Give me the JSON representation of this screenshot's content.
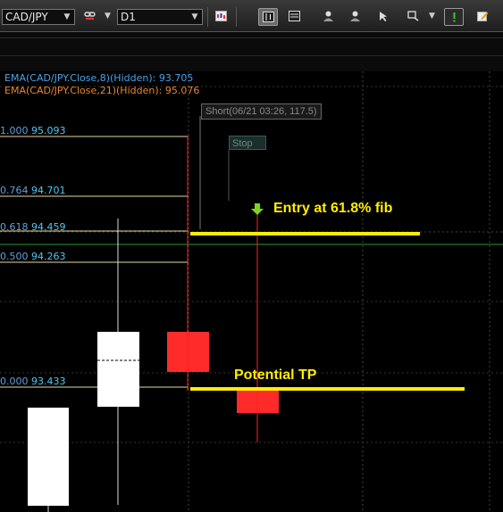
{
  "toolbar": {
    "symbol": "CAD/JPY",
    "timeframe": "D1"
  },
  "indicators": [
    {
      "text": "EMA(CAD/JPY.Close,8)(Hidden): 93.705",
      "color": "#4aa3e8"
    },
    {
      "text": "EMA(CAD/JPY.Close,21)(Hidden): 95.076",
      "color": "#e8862a"
    }
  ],
  "fib_levels": [
    {
      "ratio": "1.000",
      "price": "95.093"
    },
    {
      "ratio": "0.764",
      "price": "94.701"
    },
    {
      "ratio": "0.618",
      "price": "94.459"
    },
    {
      "ratio": "0.500",
      "price": "94.263"
    },
    {
      "ratio": "0.000",
      "price": "93.433"
    }
  ],
  "order_labels": {
    "short": "Short(06/21 03:26, 117.5)",
    "stop": "Stop"
  },
  "annotations": {
    "entry": "Entry at 61.8% fib",
    "tp": "Potential TP"
  },
  "colors": {
    "bull_candle": "#ffffff",
    "bear_candle": "#ff2a2a",
    "annotation": "#ffee00",
    "fib_line": "#e8d8a0",
    "vertical_marker": "#ff2020"
  }
}
